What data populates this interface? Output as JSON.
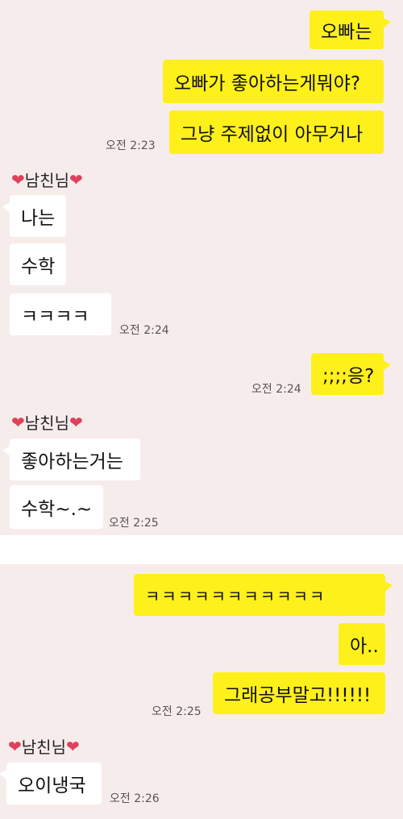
{
  "sender_name": "남친님",
  "heart_icon": "❤",
  "panel1": {
    "out1": "오빠는",
    "out2": "오빠가 좋아하는게뭐야?",
    "out3": "그냥 주제없이 아무거나",
    "time1": "오전 2:23",
    "in1": "나는",
    "in2": "수학",
    "in3": "ㅋㅋㅋㅋ",
    "time2": "오전 2:24",
    "out4": ";;;;응?",
    "time3": "오전 2:24",
    "in4": "좋아하는거는",
    "in5": "수학~.~",
    "time4": "오전 2:25"
  },
  "panel2": {
    "out1": "ㅋㅋㅋㅋㅋㅋㅋㅋㅋㅋㅋ",
    "out2": "아..",
    "out3": "그래공부말고!!!!!!",
    "time1": "오전 2:25",
    "in1": "오이냉국",
    "time2": "오전 2:26"
  }
}
